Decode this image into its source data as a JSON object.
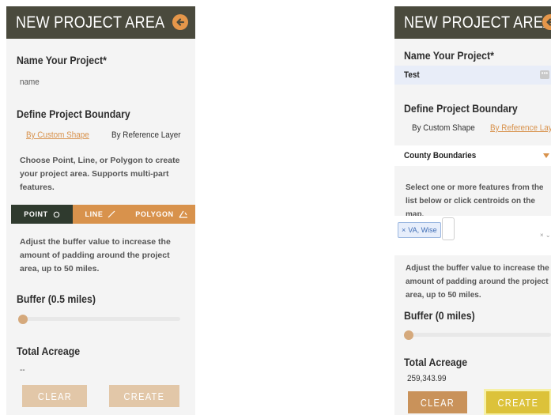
{
  "panel_a": {
    "title": "NEW PROJECT AREA",
    "name_label": "Name Your Project*",
    "name_placeholder": "name",
    "boundary_label": "Define Project Boundary",
    "tab_custom": "By Custom Shape",
    "tab_reference": "By Reference Layer",
    "instructions": "Choose Point, Line, or Polygon to create your project area. Supports multi-part features.",
    "geom_point": "POINT",
    "geom_line": "LINE",
    "geom_polygon": "POLYGON",
    "buffer_help": "Adjust the buffer value to increase the amount of padding around the project area, up to 50 miles.",
    "buffer_label": "Buffer (0.5 miles)",
    "buffer_value_fraction": 0.01,
    "acreage_label": "Total Acreage",
    "acreage_value": "--",
    "clear_label": "CLEAR",
    "create_label": "CREATE"
  },
  "panel_b": {
    "title": "NEW PROJECT AREA",
    "name_label": "Name Your Project*",
    "name_value": "Test",
    "boundary_label": "Define Project Boundary",
    "tab_custom": "By Custom Shape",
    "tab_reference": "By Reference Layer",
    "layer_select": "County Boundaries",
    "select_help": "Select one or more features from the list below or click centroids on the map.",
    "tag_label": "VA, Wise",
    "buffer_help": "Adjust the buffer value to increase the amount of padding around the project area, up to 50 miles.",
    "buffer_label": "Buffer (0 miles)",
    "buffer_value_fraction": 0,
    "acreage_label": "Total Acreage",
    "acreage_value": "259,343.99",
    "clear_label": "CLEAR",
    "create_label": "CREATE"
  },
  "colors": {
    "header": "#4a4a3d",
    "accent": "#d8924c",
    "back_icon": "#e5964a",
    "active_geom": "#2f3a2e",
    "clear_disabled": "#e2c7a8",
    "create_disabled": "#e2c7a8",
    "clear_enabled": "#c9925a",
    "create_enabled": "#dcc23a"
  }
}
